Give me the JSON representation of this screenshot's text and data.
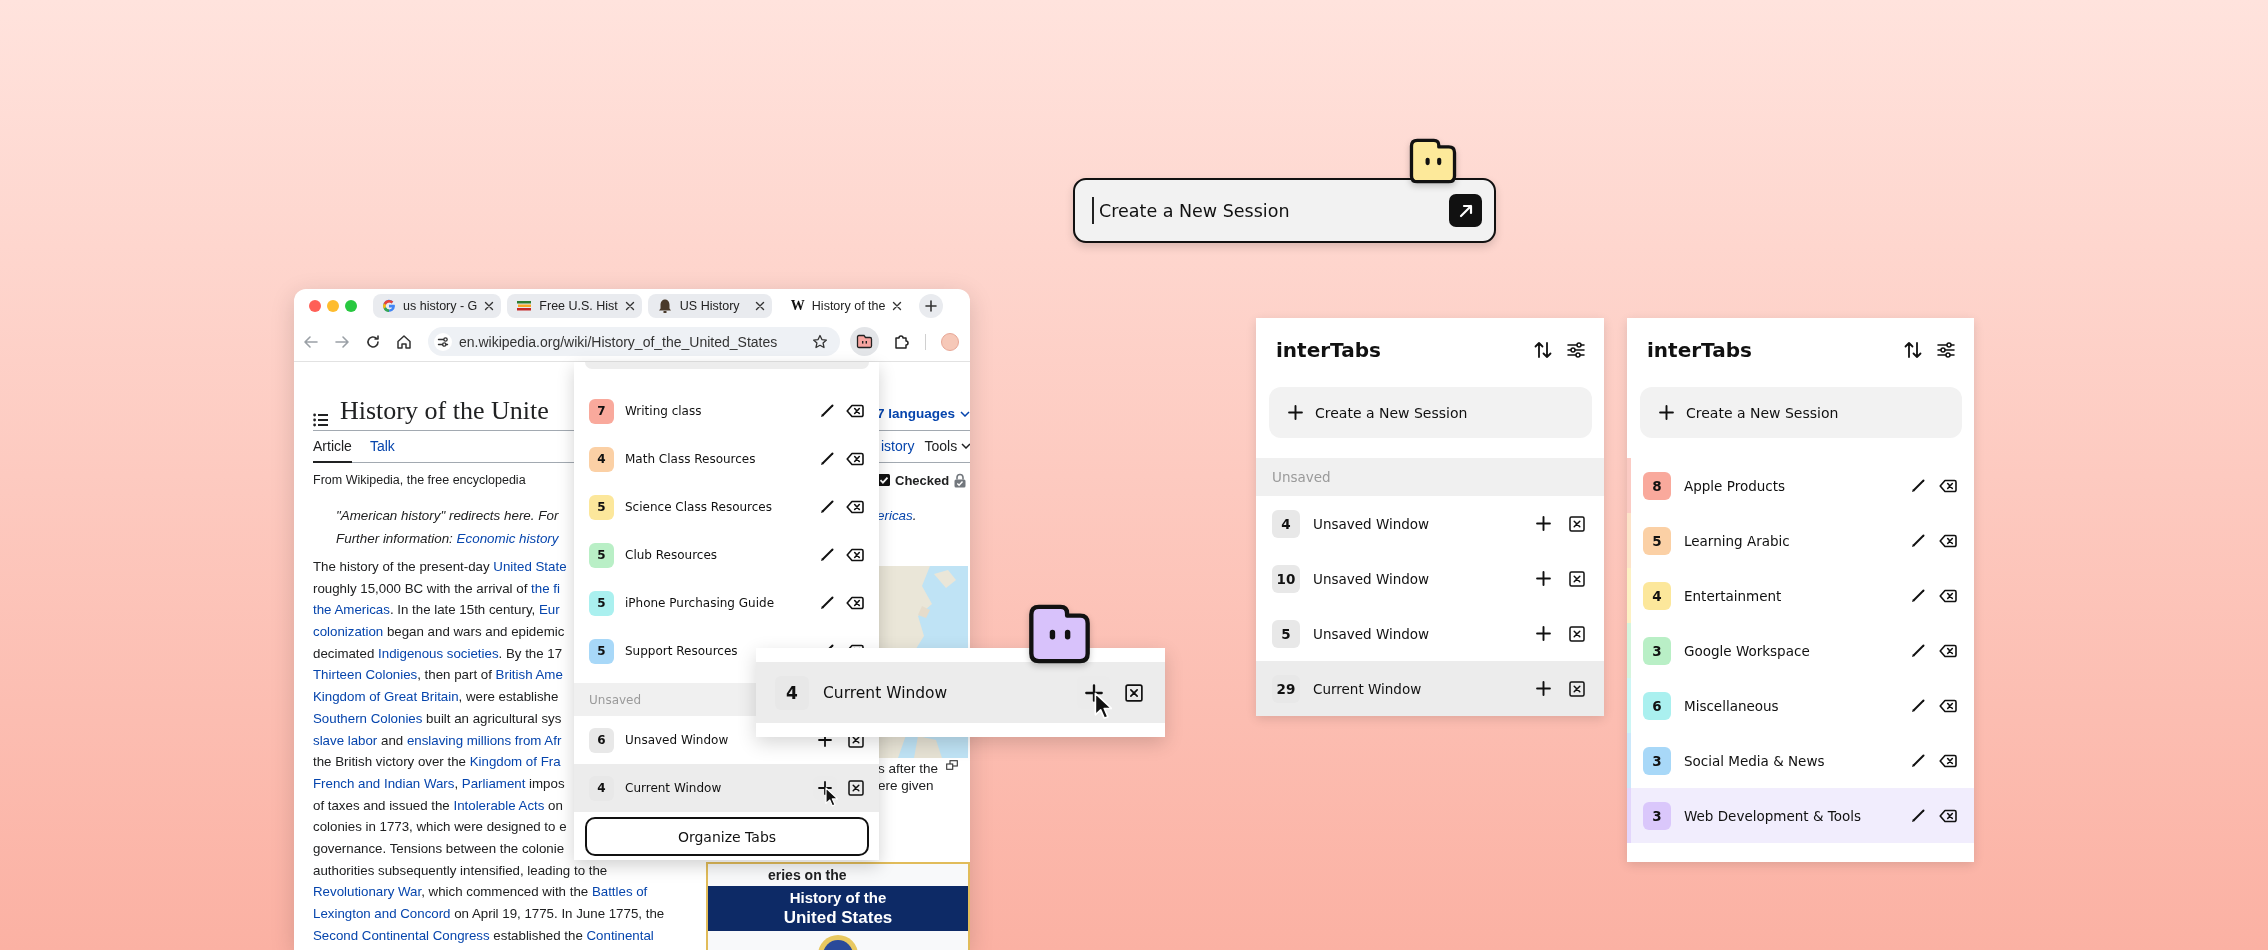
{
  "session_input": {
    "value": "Create a New Session"
  },
  "browser": {
    "tabs": [
      {
        "title": "us history - G",
        "selected": false
      },
      {
        "title": "Free U.S. Hist",
        "selected": false
      },
      {
        "title": "US History",
        "selected": false
      },
      {
        "title": "History of the",
        "favicon": "W",
        "selected": true
      }
    ],
    "url": "en.wikipedia.org/wiki/History_of_the_United_States",
    "article": {
      "title": "History of the Unite",
      "languages": "7 languages",
      "tabs": [
        {
          "label": "Article",
          "selected": true
        },
        {
          "label": "Talk",
          "selected": false
        }
      ],
      "view_tabs": [
        {
          "label": "istory",
          "link": true
        },
        {
          "label": "Tools",
          "link": false
        }
      ],
      "tagline": "From Wikipedia, the free encyclopedia",
      "status": "Checked",
      "hatnote": [
        [
          {
            "text": "\"American history\" redirects here. For",
            "link": false
          }
        ],
        [
          {
            "text": "Further information: ",
            "link": false
          },
          {
            "text": "Economic history",
            "link": true
          }
        ]
      ],
      "hatnote_tail": [
        {
          "text": "ericas",
          "link": true
        },
        {
          "text": ".",
          "link": false
        }
      ],
      "body": [
        [
          {
            "text": "The history of the present-day ",
            "link": false
          },
          {
            "text": "United State",
            "link": true
          }
        ],
        [
          {
            "text": "roughly 15,000 BC with the arrival of ",
            "link": false
          },
          {
            "text": "the fi",
            "link": true
          }
        ],
        [
          {
            "text": "the Americas",
            "link": true
          },
          {
            "text": ". In the late 15th century, ",
            "link": false
          },
          {
            "text": "Eur",
            "link": true
          }
        ],
        [
          {
            "text": "colonization",
            "link": true
          },
          {
            "text": " began and wars and epidemic",
            "link": false
          }
        ],
        [
          {
            "text": "decimated ",
            "link": false
          },
          {
            "text": "Indigenous societies",
            "link": true
          },
          {
            "text": ". By the 17",
            "link": false
          }
        ],
        [
          {
            "text": "Thirteen Colonies",
            "link": true
          },
          {
            "text": ", then part of ",
            "link": false
          },
          {
            "text": "British Ame",
            "link": true
          }
        ],
        [
          {
            "text": "Kingdom of Great Britain",
            "link": true
          },
          {
            "text": ", were establishe",
            "link": false
          }
        ],
        [
          {
            "text": "Southern Colonies",
            "link": true
          },
          {
            "text": " built an agricultural sys",
            "link": false
          }
        ],
        [
          {
            "text": "slave labor",
            "link": true
          },
          {
            "text": " and ",
            "link": false
          },
          {
            "text": "enslaving millions from Afr",
            "link": true
          }
        ],
        [
          {
            "text": "the British victory over the ",
            "link": false
          },
          {
            "text": "Kingdom of Fra",
            "link": true
          }
        ],
        [
          {
            "text": "French and Indian Wars",
            "link": true
          },
          {
            "text": ", ",
            "link": false
          },
          {
            "text": "Parliament",
            "link": true
          },
          {
            "text": " impos",
            "link": false
          }
        ],
        [
          {
            "text": "of taxes and issued the ",
            "link": false
          },
          {
            "text": "Intolerable Acts",
            "link": true
          },
          {
            "text": " on",
            "link": false
          }
        ],
        [
          {
            "text": "colonies in 1773, which were designed to e",
            "link": false
          }
        ],
        [
          {
            "text": "governance. Tensions between the colonie",
            "link": false
          }
        ],
        [
          {
            "text": "authorities subsequently intensified, leading to the",
            "link": false
          }
        ],
        [
          {
            "text": "Revolutionary War",
            "link": true
          },
          {
            "text": ", which commenced with the ",
            "link": false
          },
          {
            "text": "Battles of",
            "link": true
          }
        ],
        [
          {
            "text": "Lexington and Concord",
            "link": true
          },
          {
            "text": " on April 19, 1775. In June 1775, the",
            "link": false
          }
        ],
        [
          {
            "text": "Second Continental Congress",
            "link": true
          },
          {
            "text": " established the ",
            "link": false
          },
          {
            "text": "Continental",
            "link": true
          }
        ]
      ],
      "map_caption": [
        "s after the",
        "ere given"
      ],
      "infobox": {
        "caption": "eries on the",
        "heading": [
          "History of the",
          "United States"
        ]
      }
    }
  },
  "popup": {
    "sessions": [
      {
        "count": "7",
        "name": "Writing class",
        "color": "#f9a99c",
        "selected": false
      },
      {
        "count": "4",
        "name": "Math Class Resources",
        "color": "#fbd0a5",
        "selected": false
      },
      {
        "count": "5",
        "name": "Science Class Resources",
        "color": "#fce79b",
        "selected": false
      },
      {
        "count": "5",
        "name": "Club Resources",
        "color": "#b9efc6",
        "selected": false
      },
      {
        "count": "5",
        "name": "iPhone Purchasing Guide",
        "color": "#aaf0ef",
        "selected": false
      },
      {
        "count": "5",
        "name": "Support Resources",
        "color": "#a8d8f8",
        "selected": false
      }
    ],
    "unsaved_header": "Unsaved",
    "windows": [
      {
        "count": "6",
        "name": "Unsaved Window",
        "current": false,
        "hovered": false
      },
      {
        "count": "4",
        "name": "Current Window",
        "current": true,
        "hovered": true
      }
    ],
    "organize_button": "Organize Tabs"
  },
  "drag_card": {
    "count": "4",
    "name": "Current Window",
    "current": true,
    "hovered": true
  },
  "panels": [
    {
      "title": "interTabs",
      "create_button": "Create a New Session",
      "unsaved_header": "Unsaved",
      "windows": [
        {
          "count": "4",
          "name": "Unsaved Window",
          "current": false,
          "hovered": false
        },
        {
          "count": "10",
          "name": "Unsaved Window",
          "current": false,
          "hovered": false
        },
        {
          "count": "5",
          "name": "Unsaved Window",
          "current": false,
          "hovered": false
        },
        {
          "count": "29",
          "name": "Current Window",
          "current": true,
          "hovered": false
        }
      ]
    },
    {
      "title": "interTabs",
      "create_button": "Create a New Session",
      "sessions": [
        {
          "count": "8",
          "name": "Apple Products",
          "color": "#f9a99c",
          "selected": false
        },
        {
          "count": "5",
          "name": "Learning Arabic",
          "color": "#fbd0a5",
          "selected": false
        },
        {
          "count": "4",
          "name": "Entertainment",
          "color": "#fce79b",
          "selected": false
        },
        {
          "count": "3",
          "name": "Google Workspace",
          "color": "#b9efc6",
          "selected": false
        },
        {
          "count": "6",
          "name": "Miscellaneous",
          "color": "#aaf0ef",
          "selected": false
        },
        {
          "count": "3",
          "name": "Social Media & News",
          "color": "#a8d8f8",
          "selected": false
        },
        {
          "count": "3",
          "name": "Web Development & Tools",
          "color": "#dac7fb",
          "selected": true
        }
      ]
    }
  ]
}
